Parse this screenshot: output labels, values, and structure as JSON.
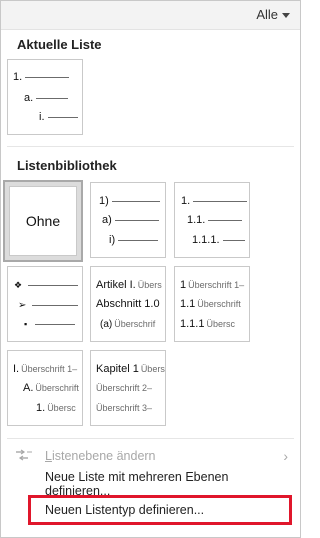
{
  "filter": {
    "label": "Alle"
  },
  "current_list": {
    "title": "Aktuelle Liste",
    "levels": [
      "1.",
      "a.",
      "i."
    ]
  },
  "library": {
    "title": "Listenbibliothek",
    "none_label": "Ohne",
    "tile2": [
      "1)",
      "a)",
      "i)"
    ],
    "tile3": [
      "1.",
      "1.1.",
      "1.1.1."
    ],
    "tile4": [
      "❖",
      "➢",
      "▪"
    ],
    "tile5": [
      {
        "main": "Artikel I.",
        "sub": "Übers"
      },
      {
        "main": "Abschnitt 1.0",
        "sub": ""
      },
      {
        "main": "(a)",
        "sub": "Überschrif"
      }
    ],
    "tile6": [
      {
        "main": "1",
        "sub": "Überschrift 1–"
      },
      {
        "main": "1.1",
        "sub": "Überschrift"
      },
      {
        "main": "1.1.1",
        "sub": "Übersc"
      }
    ],
    "tile7": [
      {
        "main": "I.",
        "sub": "Überschrift 1–"
      },
      {
        "main": "A.",
        "sub": "Überschrift"
      },
      {
        "main": "1.",
        "sub": "Übersc"
      }
    ],
    "tile8": [
      {
        "main": "Kapitel 1",
        "sub": "Übers"
      },
      {
        "main": "",
        "sub": "Überschrift 2–"
      },
      {
        "main": "",
        "sub": "Überschrift 3–"
      }
    ]
  },
  "menu": {
    "change_level": "Listenebene ändern",
    "define_multilevel": "Neue Liste mit mehreren Ebenen definieren...",
    "define_style": "Neuen Listentyp definieren...",
    "accent_highlight": "#e0162b"
  }
}
